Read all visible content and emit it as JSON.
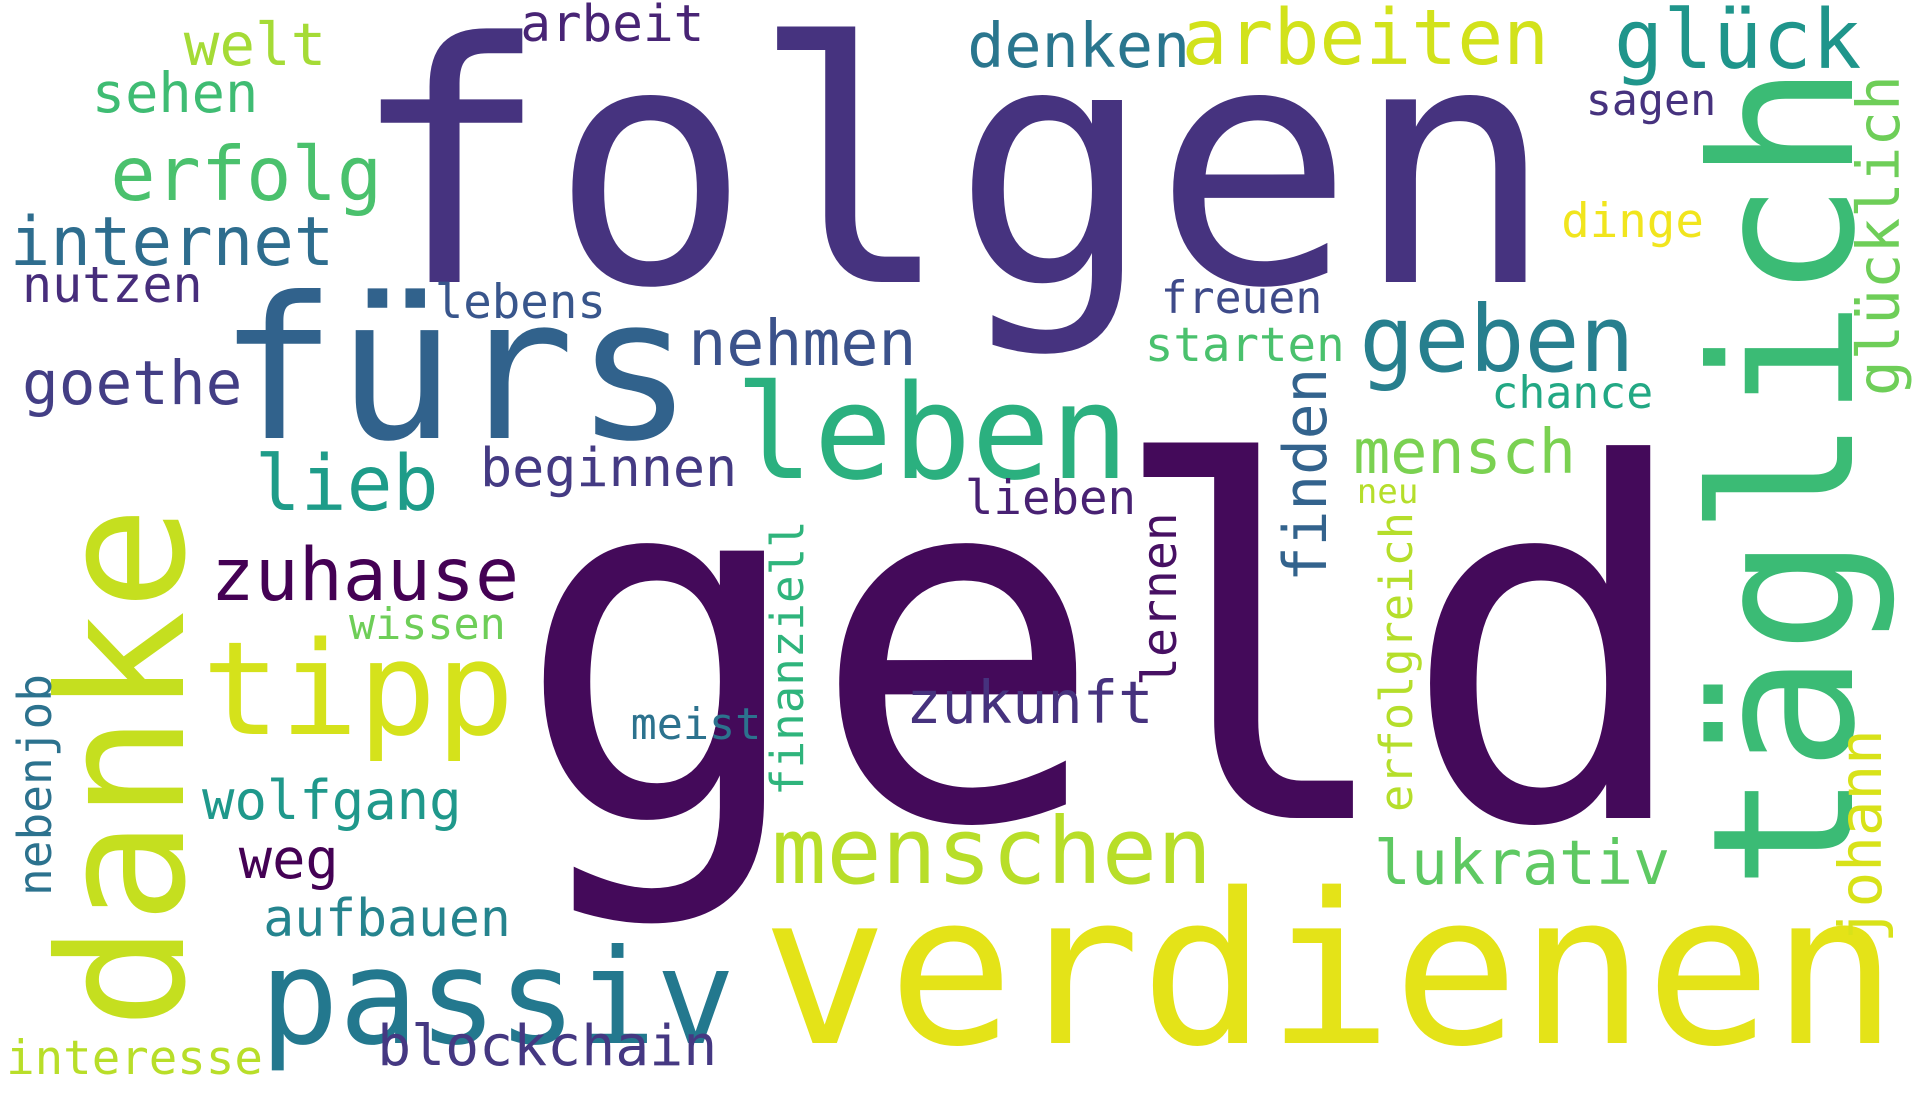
{
  "word_cloud": {
    "background_color": "#ffffff",
    "words": [
      {
        "text": "geld",
        "color": "#440a5a"
      },
      {
        "text": "folgen",
        "color": "#46337f"
      },
      {
        "text": "verdienen",
        "color": "#e4e318"
      },
      {
        "text": "täglich",
        "color": "#3bbb75"
      },
      {
        "text": "danke",
        "color": "#c5df1f"
      },
      {
        "text": "fürs",
        "color": "#31628c"
      },
      {
        "text": "leben",
        "color": "#2bb07f"
      },
      {
        "text": "passiv",
        "color": "#23788e"
      },
      {
        "text": "tipp",
        "color": "#d5e21b"
      },
      {
        "text": "menschen",
        "color": "#b8de29"
      },
      {
        "text": "glück",
        "color": "#1f958b"
      },
      {
        "text": "arbeiten",
        "color": "#d2e21b"
      },
      {
        "text": "geben",
        "color": "#277f8e"
      },
      {
        "text": "erfolg",
        "color": "#4ac16d"
      },
      {
        "text": "internet",
        "color": "#2e6d8e"
      },
      {
        "text": "zuhause",
        "color": "#440154"
      },
      {
        "text": "lieb",
        "color": "#1e9c89"
      },
      {
        "text": "mensch",
        "color": "#7ad151"
      },
      {
        "text": "nehmen",
        "color": "#3b528b"
      },
      {
        "text": "zukunft",
        "color": "#46327e"
      },
      {
        "text": "lukrativ",
        "color": "#5ec962"
      },
      {
        "text": "blockchain",
        "color": "#453882"
      },
      {
        "text": "denken",
        "color": "#2a768e"
      },
      {
        "text": "welt",
        "color": "#a5db36"
      },
      {
        "text": "sehen",
        "color": "#3fbc73"
      },
      {
        "text": "arbeit",
        "color": "#482475"
      },
      {
        "text": "beginnen",
        "color": "#443a83"
      },
      {
        "text": "wolfgang",
        "color": "#1f988b"
      },
      {
        "text": "weg",
        "color": "#440154"
      },
      {
        "text": "aufbauen",
        "color": "#25848e"
      },
      {
        "text": "goethe",
        "color": "#433e85"
      },
      {
        "text": "nutzen",
        "color": "#472d7b"
      },
      {
        "text": "finden",
        "color": "#33638d"
      },
      {
        "text": "glücklich",
        "color": "#6ece58"
      },
      {
        "text": "johann",
        "color": "#d8e219"
      },
      {
        "text": "lernen",
        "color": "#471063"
      },
      {
        "text": "erfolgreich",
        "color": "#b5de2b"
      },
      {
        "text": "finanziell",
        "color": "#2fb47c"
      },
      {
        "text": "nebenjob",
        "color": "#2c728e"
      },
      {
        "text": "interesse",
        "color": "#b8de29"
      },
      {
        "text": "lebens",
        "color": "#39568c"
      },
      {
        "text": "freuen",
        "color": "#3e4a89"
      },
      {
        "text": "starten",
        "color": "#4ac16d"
      },
      {
        "text": "chance",
        "color": "#22a884"
      },
      {
        "text": "sagen",
        "color": "#46327e"
      },
      {
        "text": "dinge",
        "color": "#f1e51d"
      },
      {
        "text": "lieben",
        "color": "#482173"
      },
      {
        "text": "neu",
        "color": "#b5de2b"
      },
      {
        "text": "wissen",
        "color": "#6ece58"
      },
      {
        "text": "meist",
        "color": "#2c728e"
      }
    ]
  }
}
